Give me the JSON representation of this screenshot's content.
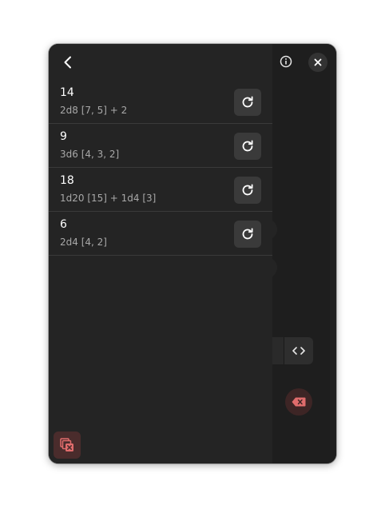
{
  "icons": {
    "back": "chevron-left-icon",
    "info": "info-icon",
    "close": "close-icon",
    "reroll": "refresh-icon",
    "code": "code-icon",
    "backspace": "backspace-icon",
    "clear": "clear-history-icon"
  },
  "colors": {
    "window_bg": "#1e1e1e",
    "sidebar_bg": "#242424",
    "button_bg": "#3a3a3a",
    "destructive": "#e06c6c"
  },
  "history": {
    "items": [
      {
        "result": "14",
        "formula": "2d8 [7, 5] + 2"
      },
      {
        "result": "9",
        "formula": "3d6 [4, 3, 2]"
      },
      {
        "result": "18",
        "formula": "1d20 [15] + 1d4 [3]"
      },
      {
        "result": "6",
        "formula": "2d4 [4, 2]"
      }
    ]
  }
}
